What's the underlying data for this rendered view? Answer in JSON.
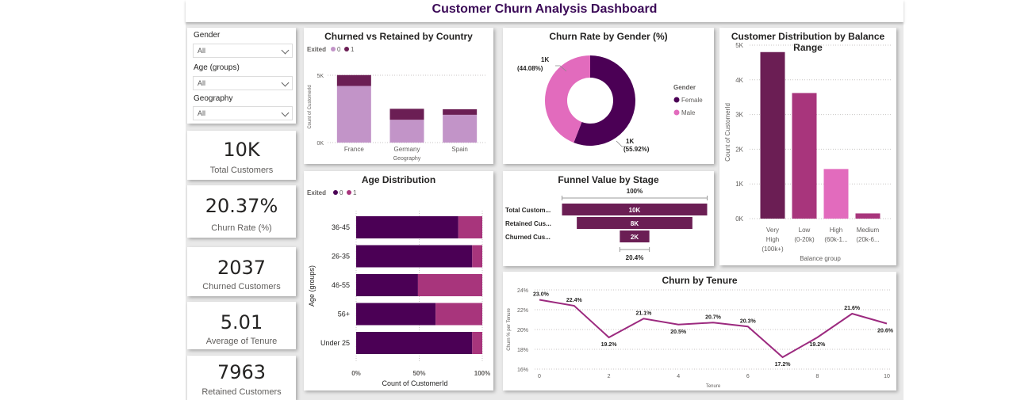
{
  "dashboard": {
    "title": "Customer Churn Analysis Dashboard"
  },
  "slicers": {
    "gender": {
      "label": "Gender",
      "value": "All"
    },
    "age": {
      "label": "Age (groups)",
      "value": "All"
    },
    "geography": {
      "label": "Geography",
      "value": "All"
    }
  },
  "kpis": [
    {
      "value": "10K",
      "label": "Total Customers"
    },
    {
      "value": "20.37%",
      "label": "Churn Rate (%)"
    },
    {
      "value": "2037",
      "label": "Churned Customers"
    },
    {
      "value": "5.01",
      "label": "Average of Tenure"
    },
    {
      "value": "7963",
      "label": "Retained Customers"
    }
  ],
  "colors": {
    "dark_purple": "#4b0055",
    "plum": "#6b1e54",
    "light_purple": "#c294c8",
    "magenta": "#a8357c",
    "pink": "#e26bbd"
  },
  "chart_data": [
    {
      "type": "bar",
      "stacked": true,
      "title": "Churned vs Retained by Country",
      "legend_title": "Exited",
      "legend": [
        "0",
        "1"
      ],
      "legend_position": "top-left",
      "xlabel": "Geography",
      "ylabel": "Count of CustomerId",
      "categories": [
        "France",
        "Germany",
        "Spain"
      ],
      "series": [
        {
          "name": "0",
          "values": [
            4204,
            1695,
            2064
          ]
        },
        {
          "name": "1",
          "values": [
            810,
            814,
            413
          ]
        }
      ],
      "yticks": [
        "0K",
        "5K"
      ],
      "ylim": [
        0,
        6000
      ]
    },
    {
      "type": "pie",
      "donut": true,
      "title": "Churn Rate by Gender (%)",
      "legend_title": "Gender",
      "legend_position": "right",
      "categories": [
        "Female",
        "Male"
      ],
      "values": [
        55.92,
        44.08
      ],
      "labels": [
        "1K",
        "1K"
      ],
      "percent_labels": [
        "(55.92%)",
        "(44.08%)"
      ]
    },
    {
      "type": "bar",
      "title": "Customer Distribution by Balance Range",
      "xlabel": "Balance group",
      "ylabel": "Count of CustomerId",
      "categories": [
        [
          "Very",
          "High",
          "(100k+)"
        ],
        [
          "Low",
          "(0-20k)"
        ],
        [
          "High",
          "(60k-1..."
        ],
        [
          "Medium",
          "(20k-6..."
        ]
      ],
      "values": [
        4800,
        3620,
        1430,
        150
      ],
      "yticks": [
        "0K",
        "1K",
        "2K",
        "3K",
        "4K",
        "5K"
      ],
      "ylim": [
        0,
        5000
      ]
    },
    {
      "type": "bar",
      "orientation": "horizontal",
      "stacked_percent": true,
      "title": "Age Distribution",
      "legend_title": "Exited",
      "legend": [
        "0",
        "1"
      ],
      "legend_position": "top-left",
      "xlabel": "Count of CustomerId",
      "ylabel": "Age (groups)",
      "categories": [
        "36-45",
        "26-35",
        "46-55",
        "56+",
        "Under 25"
      ],
      "series": [
        {
          "name": "0",
          "values": [
            81,
            92,
            49,
            63,
            92
          ]
        },
        {
          "name": "1",
          "values": [
            19,
            8,
            51,
            37,
            8
          ]
        }
      ],
      "xticks": [
        "0%",
        "50%",
        "100%"
      ],
      "xlim": [
        0,
        100
      ]
    },
    {
      "type": "bar",
      "subtype": "funnel",
      "title": "Funnel Value by Stage",
      "categories": [
        "Total Custom...",
        "Retained Cus...",
        "Churned Cus..."
      ],
      "values": [
        10000,
        7963,
        2037
      ],
      "labels": [
        "10K",
        "8K",
        "2K"
      ],
      "top_label": "100%",
      "bottom_label": "20.4%"
    },
    {
      "type": "line",
      "title": "Churn by Tenure",
      "xlabel": "Tenure",
      "ylabel": "Churn % per Tenure",
      "x": [
        0,
        1,
        2,
        3,
        4,
        5,
        6,
        7,
        8,
        9,
        10
      ],
      "values": [
        23.0,
        22.4,
        19.2,
        21.1,
        20.5,
        20.7,
        20.3,
        17.2,
        19.2,
        21.6,
        20.6
      ],
      "labels": [
        "23.0%",
        "22.4%",
        "19.2%",
        "21.1%",
        "20.5%",
        "20.7%",
        "20.3%",
        "17.2%",
        "19.2%",
        "21.6%",
        "20.6%"
      ],
      "xticks": [
        "0",
        "2",
        "4",
        "6",
        "8",
        "10"
      ],
      "yticks": [
        "16%",
        "18%",
        "20%",
        "22%",
        "24%"
      ],
      "ylim": [
        16,
        24
      ]
    }
  ]
}
